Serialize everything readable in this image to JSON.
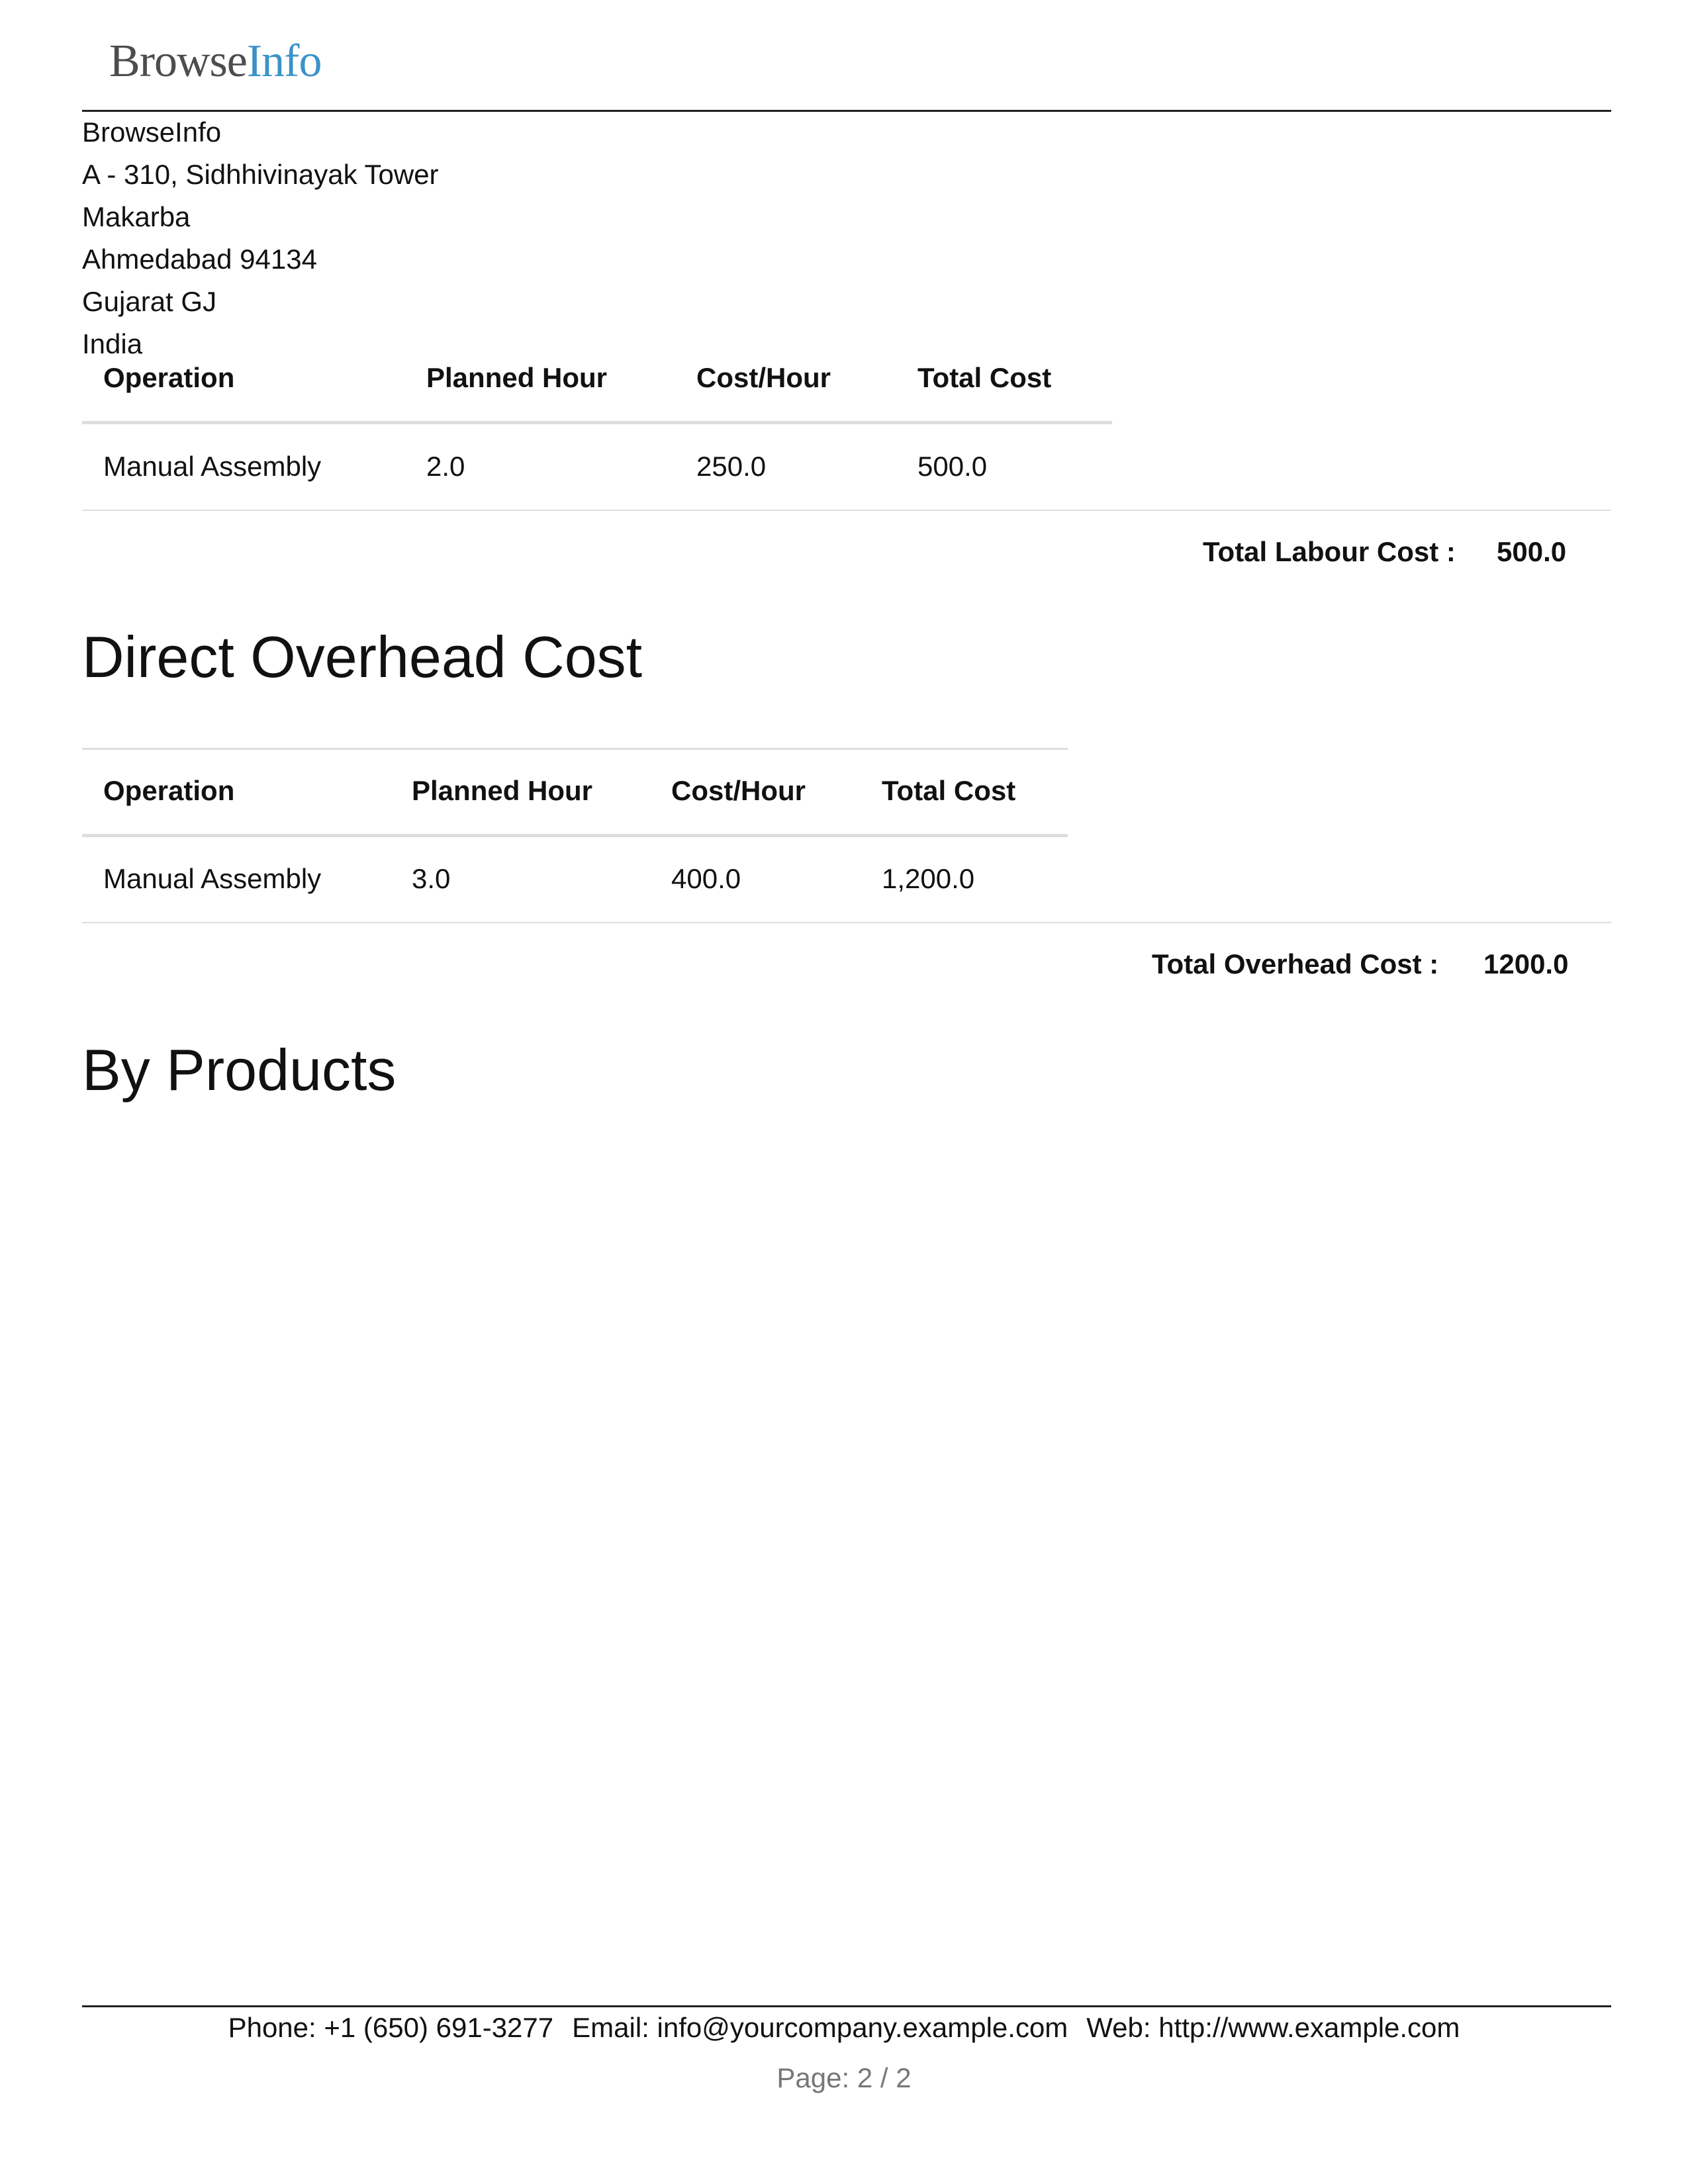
{
  "header": {
    "logo_part1": "Browse",
    "logo_part2": "Info"
  },
  "company": {
    "lines": [
      "BrowseInfo",
      "A - 310, Sidhhivinayak Tower",
      "Makarba",
      "Ahmedabad 94134",
      "Gujarat GJ",
      "India"
    ]
  },
  "labour_table": {
    "columns": [
      "Operation",
      "Planned Hour",
      "Cost/Hour",
      "Total Cost"
    ],
    "rows": [
      [
        "Manual Assembly",
        "2.0",
        "250.0",
        "500.0"
      ]
    ],
    "total_label": "Total Labour Cost :",
    "total_value": "500.0"
  },
  "overhead_section": {
    "title": "Direct Overhead Cost",
    "columns": [
      "Operation",
      "Planned Hour",
      "Cost/Hour",
      "Total Cost"
    ],
    "rows": [
      [
        "Manual Assembly",
        "3.0",
        "400.0",
        "1,200.0"
      ]
    ],
    "total_label": "Total Overhead Cost :",
    "total_value": "1200.0"
  },
  "by_products": {
    "title": "By Products"
  },
  "footer": {
    "phone": "Phone: +1 (650) 691-3277",
    "email": "Email: info@yourcompany.example.com",
    "web": "Web: http://www.example.com",
    "page": "Page: 2 / 2"
  }
}
